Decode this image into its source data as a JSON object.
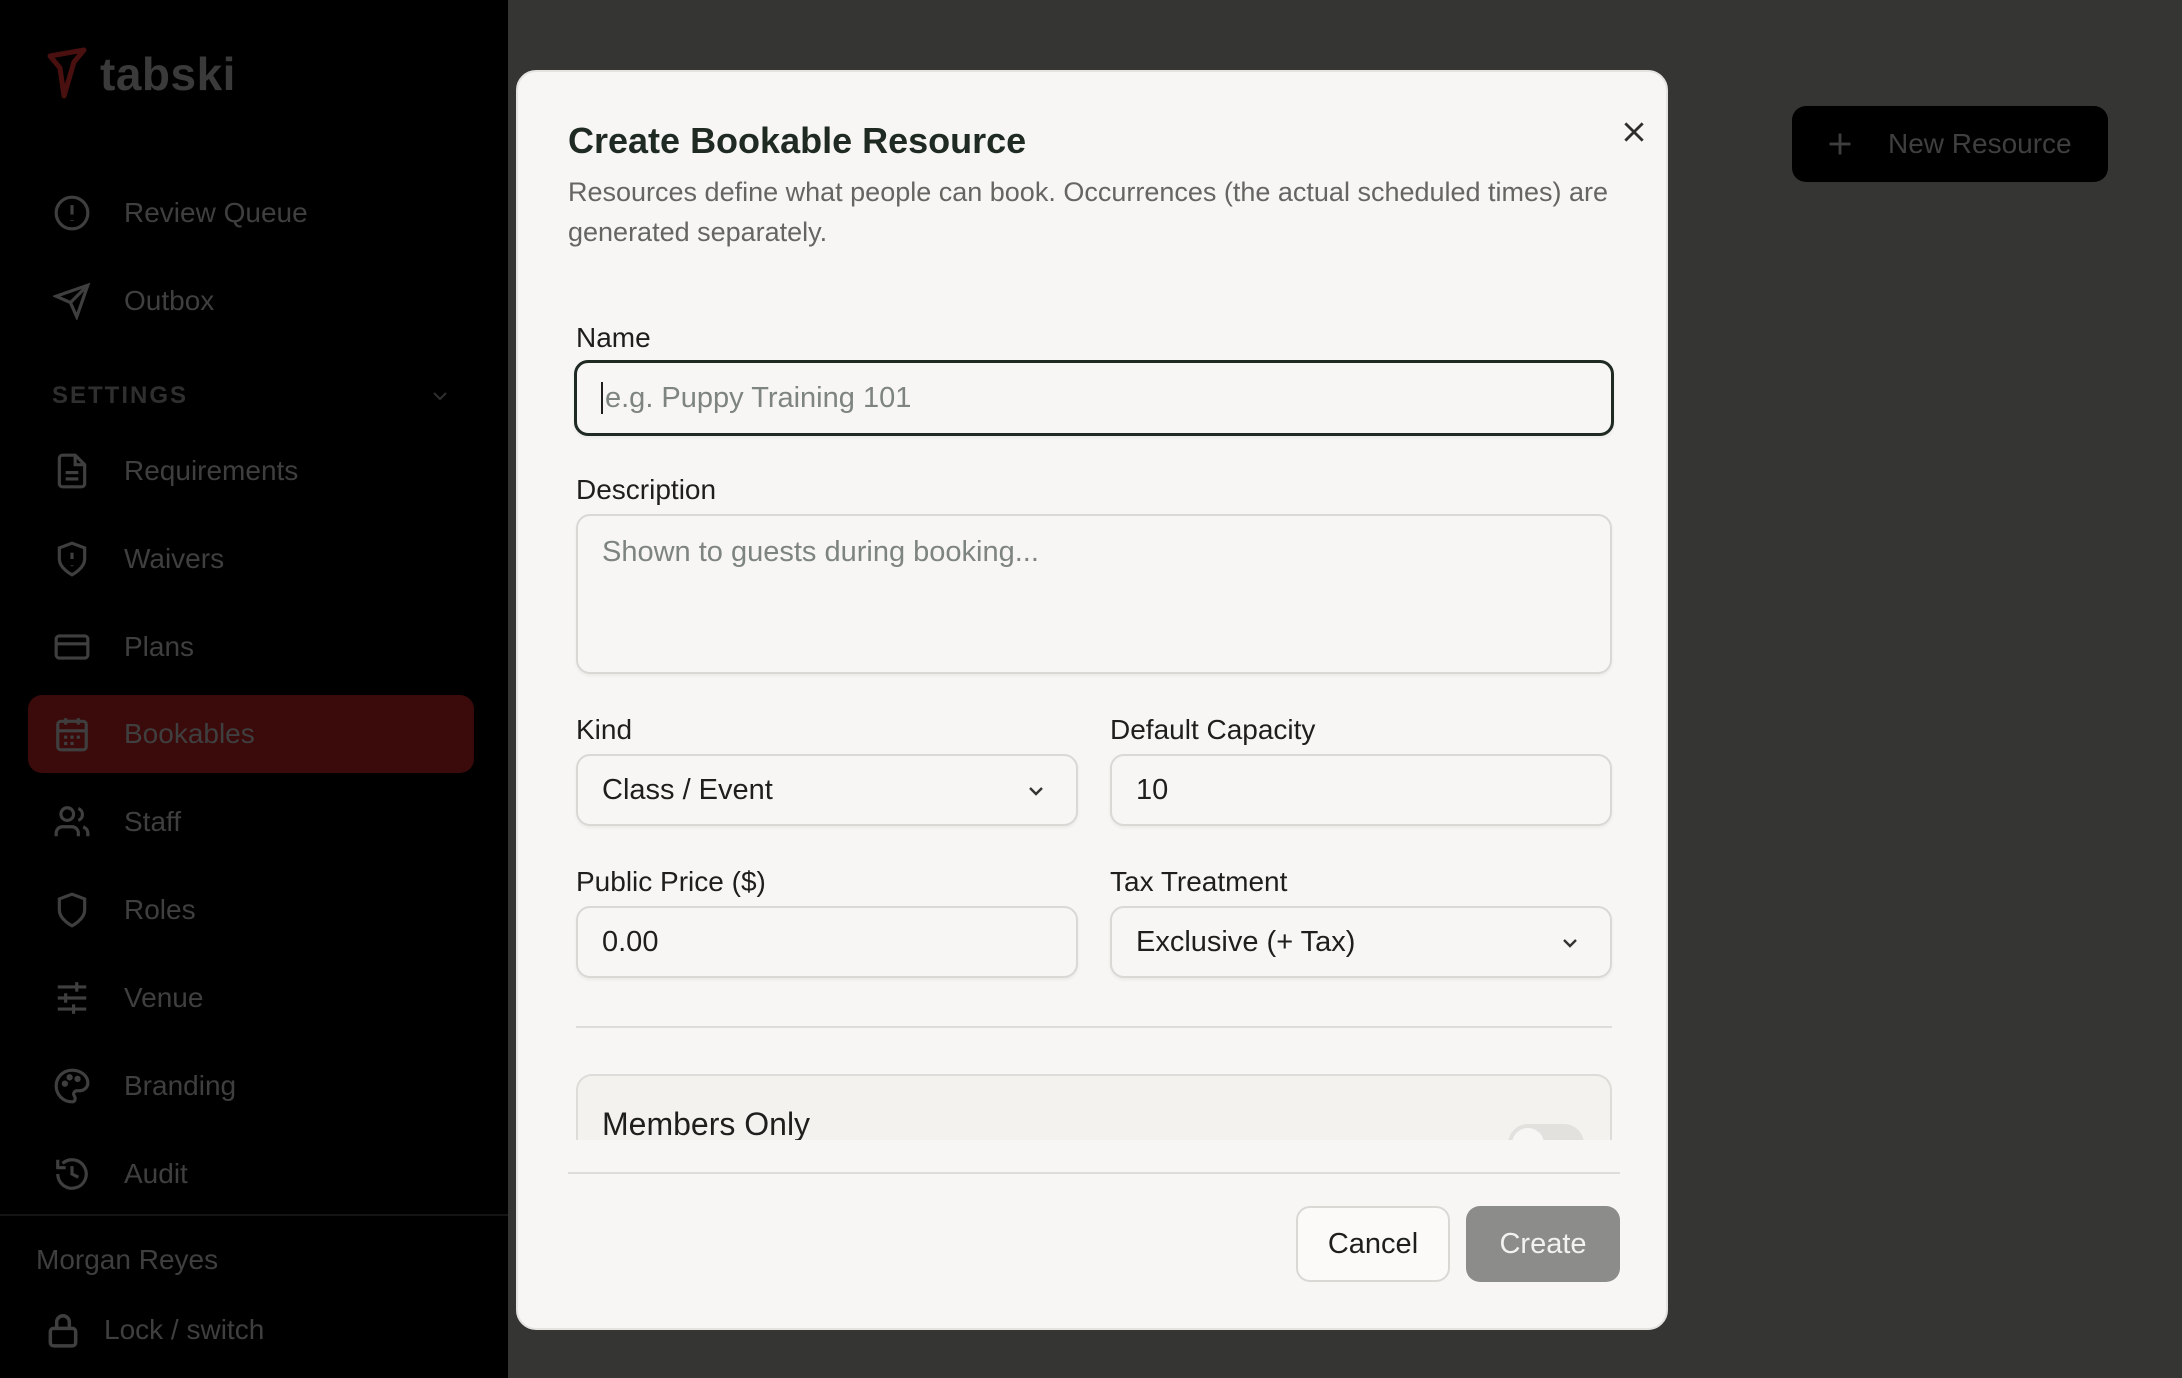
{
  "app": {
    "name": "tabski",
    "brand_color": "#7a1a1a"
  },
  "sidebar": {
    "top_items": [
      {
        "label": "Review Queue",
        "icon": "alert-circle-icon"
      },
      {
        "label": "Outbox",
        "icon": "send-icon"
      }
    ],
    "section_label": "SETTINGS",
    "settings_items": [
      {
        "label": "Requirements",
        "icon": "document-icon"
      },
      {
        "label": "Waivers",
        "icon": "shield-alert-icon"
      },
      {
        "label": "Plans",
        "icon": "credit-card-icon"
      },
      {
        "label": "Bookables",
        "icon": "calendar-icon",
        "active": true
      },
      {
        "label": "Staff",
        "icon": "users-icon"
      },
      {
        "label": "Roles",
        "icon": "shield-icon"
      },
      {
        "label": "Venue",
        "icon": "sliders-icon"
      },
      {
        "label": "Branding",
        "icon": "palette-icon"
      },
      {
        "label": "Audit",
        "icon": "history-icon"
      }
    ],
    "user_name": "Morgan Reyes",
    "lock_label": "Lock / switch"
  },
  "header": {
    "new_resource_label": "New Resource"
  },
  "modal": {
    "title": "Create Bookable Resource",
    "description": "Resources define what people can book. Occurrences (the actual scheduled times) are generated separately.",
    "name": {
      "label": "Name",
      "placeholder": "e.g. Puppy Training 101",
      "value": ""
    },
    "description_field": {
      "label": "Description",
      "placeholder": "Shown to guests during booking...",
      "value": ""
    },
    "kind": {
      "label": "Kind",
      "value": "Class / Event"
    },
    "default_capacity": {
      "label": "Default Capacity",
      "value": "10"
    },
    "public_price": {
      "label": "Public Price ($)",
      "value": "0.00"
    },
    "tax_treatment": {
      "label": "Tax Treatment",
      "value": "Exclusive (+ Tax)"
    },
    "members_only": {
      "label": "Members Only",
      "enabled": false
    },
    "cancel_label": "Cancel",
    "create_label": "Create"
  }
}
